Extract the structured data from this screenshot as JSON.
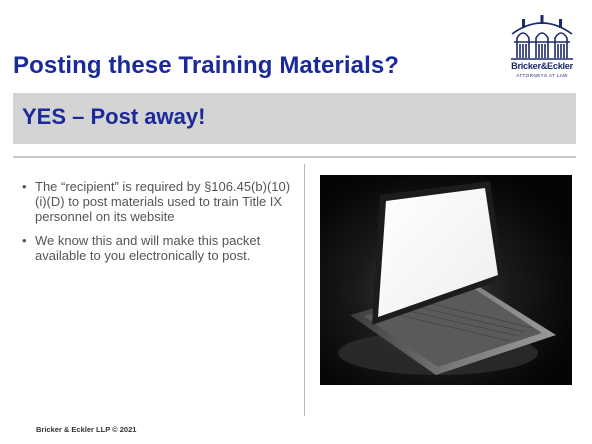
{
  "slide": {
    "title": "Posting these Training Materials?",
    "banner": "YES – Post away!",
    "bullets": [
      "The “recipient” is required by §106.45(b)(10)(i)(D) to post materials used to train Title IX personnel on its website",
      "We know this and will make this packet available to you electronically to post."
    ],
    "footer": "Bricker & Eckler LLP © 2021"
  },
  "logo": {
    "name": "Bricker&Eckler",
    "tagline": "ATTORNEYS AT LAW",
    "icon": "building-facade-icon"
  },
  "image": {
    "icon": "laptop-photo"
  },
  "colors": {
    "title": "#1b2a9a",
    "banner_bg": "#d4d4d4",
    "body_text": "#555555"
  }
}
